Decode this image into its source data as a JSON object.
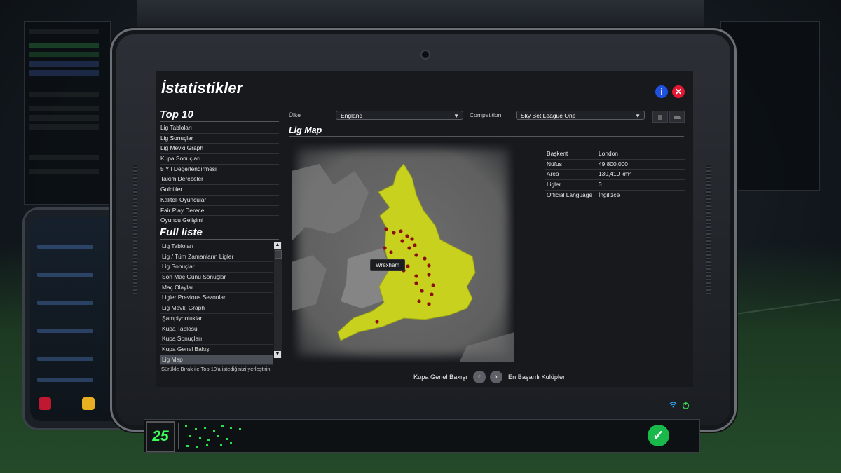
{
  "screen": {
    "title": "İstatistikler",
    "info_icon_glyph": "i",
    "close_icon_glyph": "✕"
  },
  "top10": {
    "heading": "Top 10",
    "items": [
      "Lig Tabloları",
      "Lig Sonuçlar",
      "Lig Mevki Graph",
      "Kupa Sonuçları",
      "5 Yıl Değerlendirmesi",
      "Takım Dereceler",
      "Golcüler",
      "Kaliteli Oyuncular",
      "Fair Play Derece",
      "Oyuncu Gelişimi"
    ]
  },
  "full_list": {
    "heading": "Full liste",
    "items": [
      "Lig Tabloları",
      "Lig / Tüm Zamanların Ligler",
      "Lig Sonuçlar",
      "Son Maç Günü Sonuçlar",
      "Maç Olaylar",
      "Ligler Previous Sezonlar",
      "Lig Mevki Graph",
      "Şampiyonluklar",
      "Kupa Tablosu",
      "Kupa Sonuçları",
      "Kupa Genel Bakışı",
      "Lig Map"
    ],
    "selected": "Lig Map",
    "hint": "Sürükle Bırak ile Top 10'a istediğinizi yerleştirin."
  },
  "filters": {
    "country_label": "Ülke",
    "country_value": "England",
    "competition_label": "Competition",
    "competition_value": "Sky Bet League One"
  },
  "map": {
    "title": "Lig Map",
    "tooltip": "Wrexham",
    "land_color": "#c8d21e",
    "marker_color": "#8a1010"
  },
  "country_stats": [
    {
      "key": "Başkent",
      "value": "London"
    },
    {
      "key": "Nüfus",
      "value": "49,800,000"
    },
    {
      "key": "Area",
      "value": "130,410 km²"
    },
    {
      "key": "Ligler",
      "value": "3"
    },
    {
      "key": "Official Language",
      "value": "İngilizce"
    }
  ],
  "navigation": {
    "prev_label": "Kupa Genel Bakışı",
    "next_label": "En Başarılı Kulüpler"
  },
  "bottom_bar": {
    "day": "25",
    "continue_color": "#18b84a"
  }
}
